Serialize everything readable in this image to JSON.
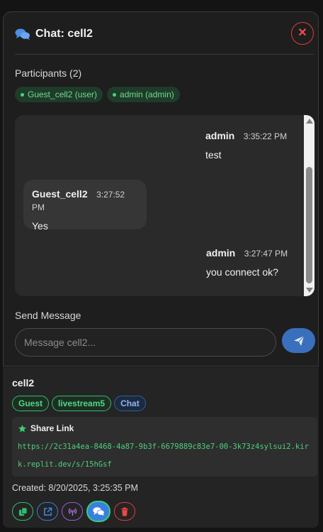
{
  "chat": {
    "title": "Chat: cell2",
    "participants_label": "Participants (2)",
    "participants": [
      "Guest_cell2 (user)",
      "admin (admin)"
    ],
    "messages": [
      {
        "sender": "admin",
        "time": "3:35:22 PM",
        "text": "test",
        "align": "right"
      },
      {
        "sender": "Guest_cell2",
        "time": "3:27:52 PM",
        "text": "Yes",
        "align": "left"
      },
      {
        "sender": "admin",
        "time": "3:27:47 PM",
        "text": "you connect ok?",
        "align": "right"
      }
    ],
    "send_label": "Send Message",
    "input_placeholder": "Message cell2..."
  },
  "card": {
    "title": "cell2",
    "tags": [
      "Guest",
      "livestream5",
      "Chat"
    ],
    "share_title": "Share Link",
    "share_url": "https://2c31a4ea-8468-4a87-9b3f-6679889c83e7-00-3k73z4sylsui2.kirk.replit.dev/s/15hGsf",
    "created": "Created: 8/20/2025, 3:25:35 PM"
  },
  "colors": {
    "accent_blue": "#3a6fbd",
    "status_green": "#2fbf6b",
    "close_red": "#e23b3b"
  },
  "icons": [
    "chat-bubbles-icon",
    "close-icon",
    "send-icon",
    "star-icon",
    "copy-icon",
    "external-link-icon",
    "broadcast-icon",
    "chat-icon",
    "trash-icon"
  ]
}
